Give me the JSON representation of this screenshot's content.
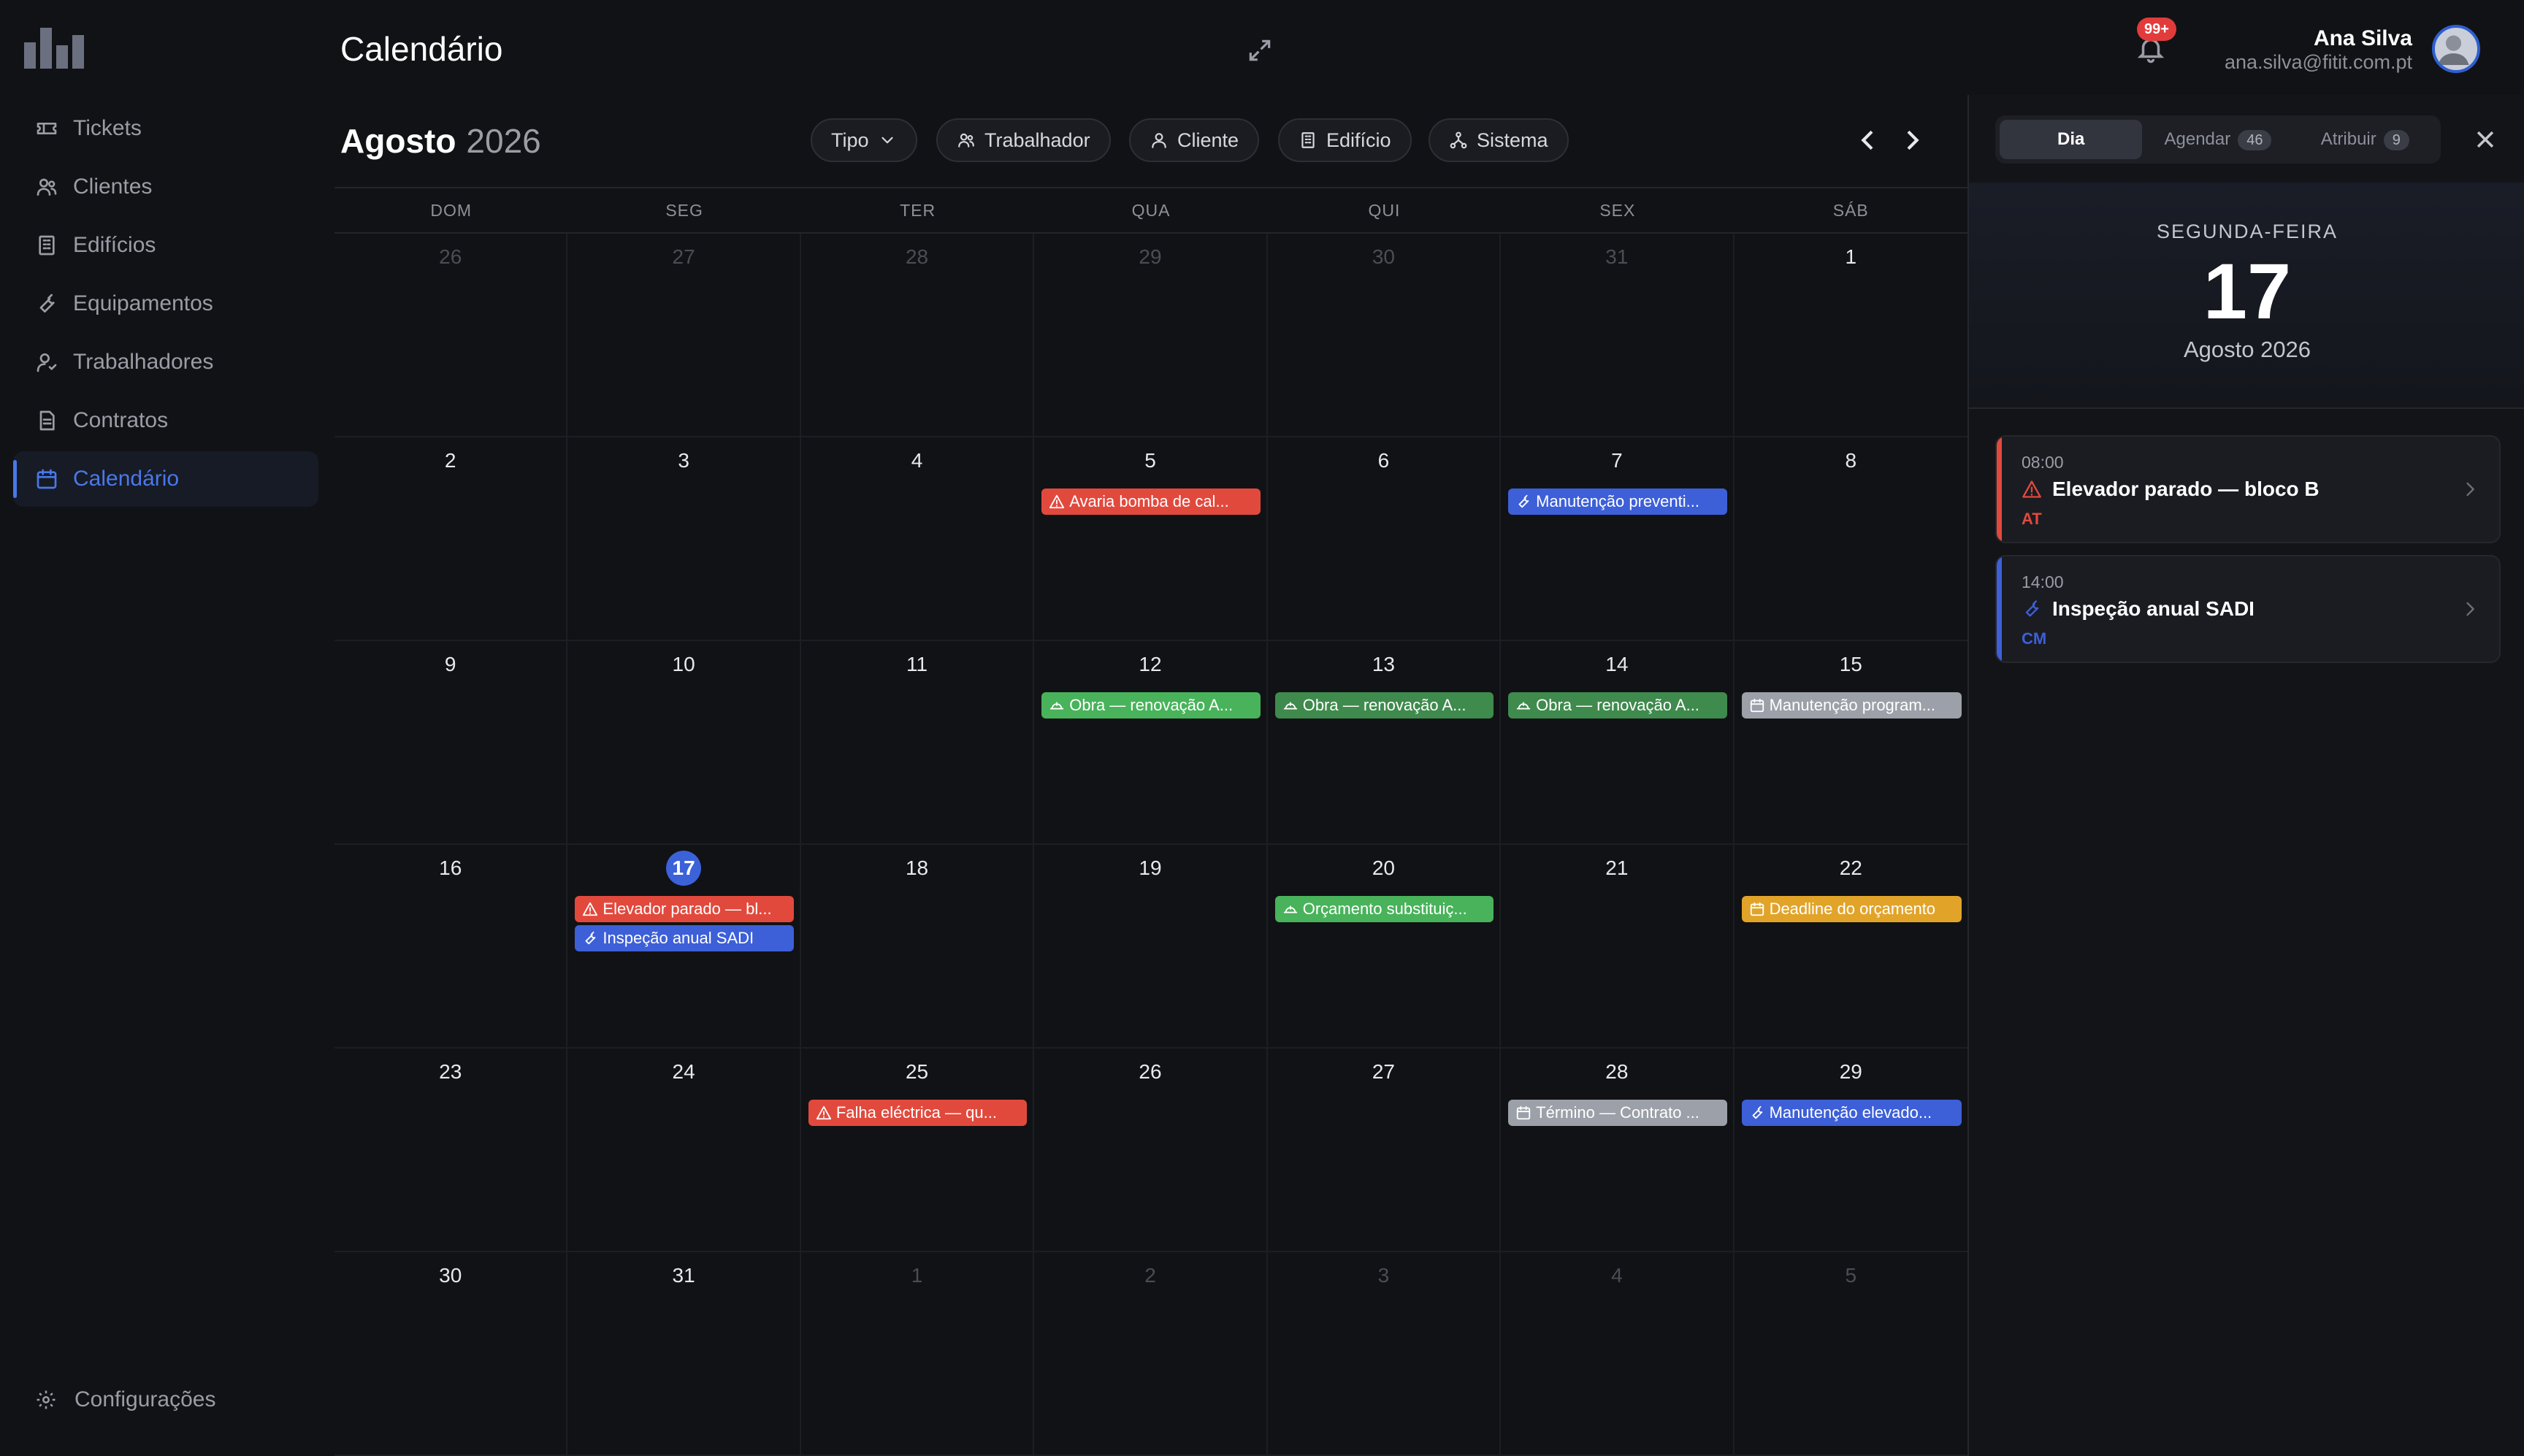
{
  "header": {
    "title": "Calendário",
    "notifications_badge": "99+",
    "user": {
      "name": "Ana Silva",
      "email": "ana.silva@fitit.com.pt"
    }
  },
  "sidebar": {
    "items": [
      {
        "label": "Tickets",
        "icon": "ticket-icon",
        "active": false
      },
      {
        "label": "Clientes",
        "icon": "users-icon",
        "active": false
      },
      {
        "label": "Edifícios",
        "icon": "building-icon",
        "active": false
      },
      {
        "label": "Equipamentos",
        "icon": "wrench-icon",
        "active": false
      },
      {
        "label": "Trabalhadores",
        "icon": "worker-icon",
        "active": false
      },
      {
        "label": "Contratos",
        "icon": "document-icon",
        "active": false
      },
      {
        "label": "Calendário",
        "icon": "calendar-icon",
        "active": true
      }
    ],
    "settings_label": "Configurações"
  },
  "calendar": {
    "month": "Agosto",
    "year": "2026",
    "filters": [
      {
        "label": "Tipo",
        "icon": "chevron-down-icon"
      },
      {
        "label": "Trabalhador",
        "icon": "users-icon"
      },
      {
        "label": "Cliente",
        "icon": "user-icon"
      },
      {
        "label": "Edifício",
        "icon": "building-icon"
      },
      {
        "label": "Sistema",
        "icon": "network-icon"
      }
    ],
    "weekdays": [
      "DOM",
      "SEG",
      "TER",
      "QUA",
      "QUI",
      "SEX",
      "SÁB"
    ],
    "days": [
      {
        "n": "26",
        "out": true
      },
      {
        "n": "27",
        "out": true
      },
      {
        "n": "28",
        "out": true
      },
      {
        "n": "29",
        "out": true
      },
      {
        "n": "30",
        "out": true
      },
      {
        "n": "31",
        "out": true
      },
      {
        "n": "1"
      },
      {
        "n": "2"
      },
      {
        "n": "3"
      },
      {
        "n": "4"
      },
      {
        "n": "5",
        "events": [
          {
            "label": "Avaria bomba de cal...",
            "color": "red",
            "icon": "alert-icon"
          }
        ]
      },
      {
        "n": "6"
      },
      {
        "n": "7",
        "events": [
          {
            "label": "Manutenção preventi...",
            "color": "blue",
            "icon": "wrench-icon"
          }
        ]
      },
      {
        "n": "8"
      },
      {
        "n": "9"
      },
      {
        "n": "10"
      },
      {
        "n": "11"
      },
      {
        "n": "12",
        "events": [
          {
            "label": "Obra — renovação A...",
            "color": "green",
            "icon": "helmet-icon"
          }
        ]
      },
      {
        "n": "13",
        "events": [
          {
            "label": "Obra — renovação A...",
            "color": "dg",
            "icon": "helmet-icon"
          }
        ]
      },
      {
        "n": "14",
        "events": [
          {
            "label": "Obra — renovação A...",
            "color": "dg",
            "icon": "helmet-icon"
          }
        ]
      },
      {
        "n": "15",
        "events": [
          {
            "label": "Manutenção program...",
            "color": "gray",
            "icon": "calendar-icon"
          }
        ]
      },
      {
        "n": "16"
      },
      {
        "n": "17",
        "today": true,
        "events": [
          {
            "label": "Elevador parado — bl...",
            "color": "red",
            "icon": "alert-icon"
          },
          {
            "label": "Inspeção anual SADI",
            "color": "blue",
            "icon": "wrench-icon"
          }
        ]
      },
      {
        "n": "18"
      },
      {
        "n": "19"
      },
      {
        "n": "20",
        "events": [
          {
            "label": "Orçamento substituiç...",
            "color": "green",
            "icon": "helmet-icon"
          }
        ]
      },
      {
        "n": "21"
      },
      {
        "n": "22",
        "events": [
          {
            "label": "Deadline do orçamento",
            "color": "yellow",
            "icon": "calendar-icon"
          }
        ]
      },
      {
        "n": "23"
      },
      {
        "n": "24"
      },
      {
        "n": "25",
        "events": [
          {
            "label": "Falha eléctrica — qu...",
            "color": "red",
            "icon": "alert-icon"
          }
        ]
      },
      {
        "n": "26"
      },
      {
        "n": "27"
      },
      {
        "n": "28",
        "events": [
          {
            "label": "Término — Contrato ...",
            "color": "gray",
            "icon": "calendar-icon"
          }
        ]
      },
      {
        "n": "29",
        "events": [
          {
            "label": "Manutenção elevado...",
            "color": "blue",
            "icon": "wrench-icon"
          }
        ]
      },
      {
        "n": "30"
      },
      {
        "n": "31"
      },
      {
        "n": "1",
        "out": true
      },
      {
        "n": "2",
        "out": true
      },
      {
        "n": "3",
        "out": true
      },
      {
        "n": "4",
        "out": true
      },
      {
        "n": "5",
        "out": true
      }
    ]
  },
  "panel": {
    "tabs": [
      {
        "label": "Dia",
        "count": "",
        "active": true
      },
      {
        "label": "Agendar",
        "count": "46",
        "active": false
      },
      {
        "label": "Atribuir",
        "count": "9",
        "active": false
      }
    ],
    "weekday": "SEGUNDA-FEIRA",
    "day": "17",
    "month_year": "Agosto 2026",
    "events": [
      {
        "time": "08:00",
        "title": "Elevador parado — bloco B",
        "tag": "AT",
        "color": "#e2493d",
        "icon": "alert-icon"
      },
      {
        "time": "14:00",
        "title": "Inspeção anual SADI",
        "tag": "CM",
        "color": "#3d5fd8",
        "icon": "wrench-icon"
      }
    ]
  },
  "colors": {
    "accent": "#3b62d9",
    "red": "#e2493d",
    "blue": "#3d5fd8",
    "green": "#48b35a",
    "gray": "#9ca0a8",
    "yellow": "#e1a429"
  }
}
